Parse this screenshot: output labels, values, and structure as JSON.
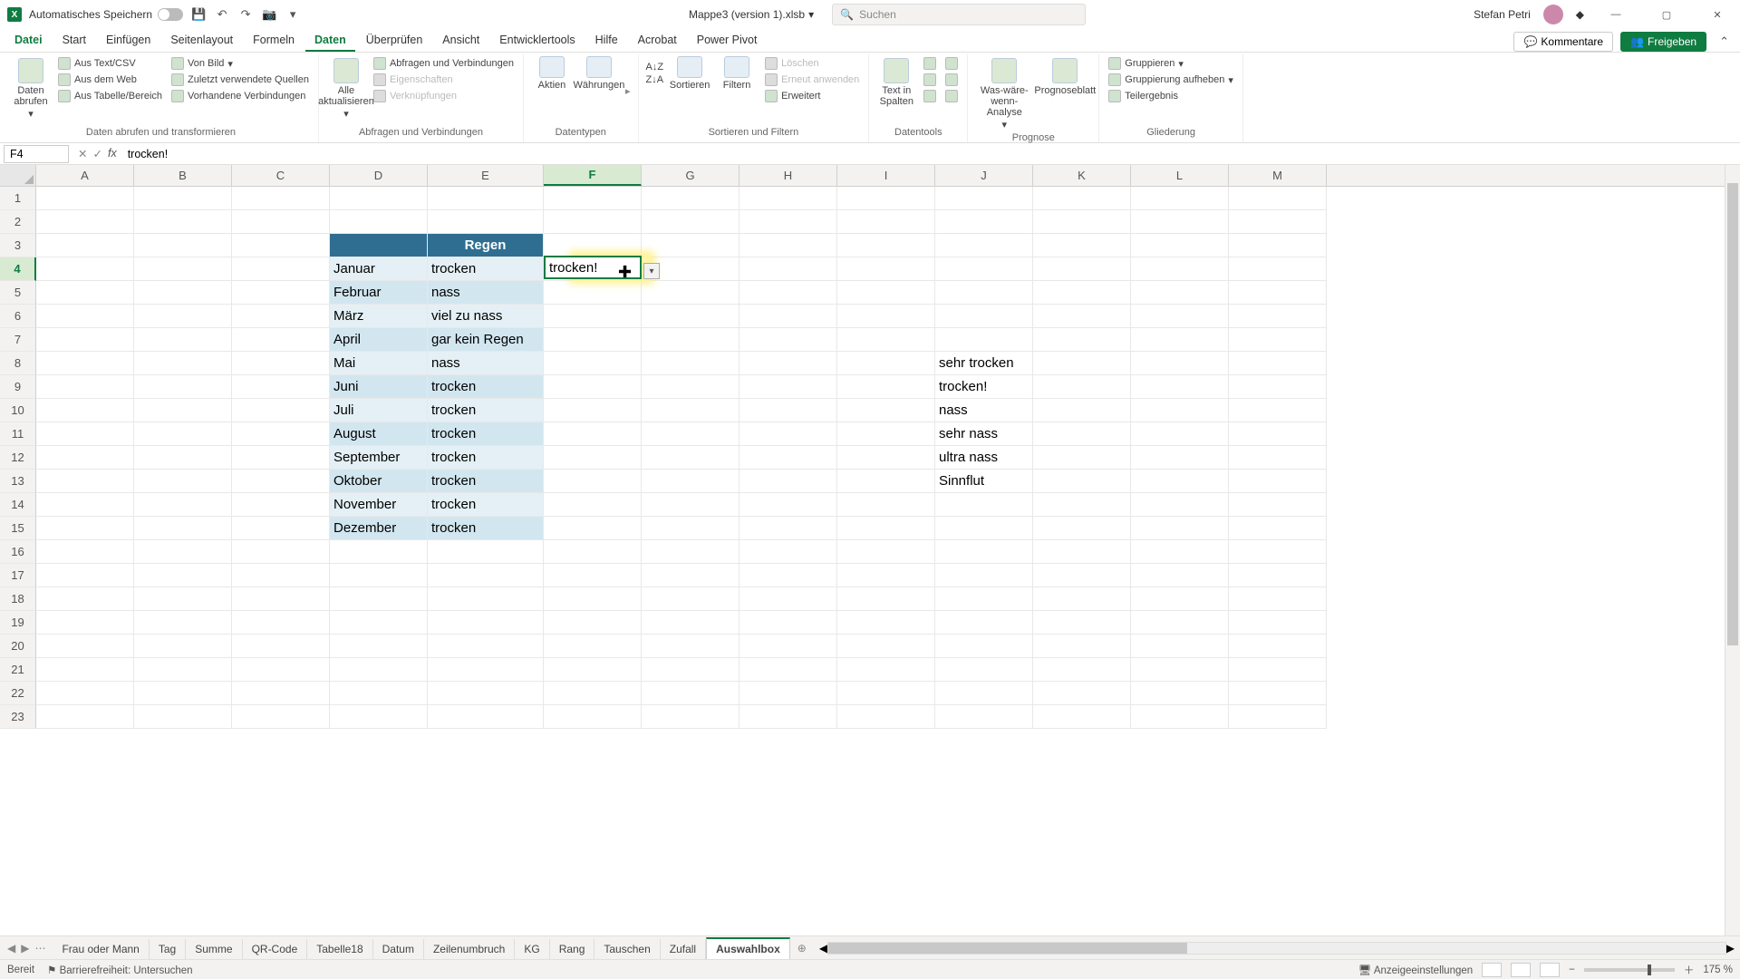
{
  "titlebar": {
    "auto_save": "Automatisches Speichern",
    "filename": "Mappe3 (version 1).xlsb",
    "search_placeholder": "Suchen",
    "username": "Stefan Petri"
  },
  "tabs": {
    "file": "Datei",
    "items": [
      "Start",
      "Einfügen",
      "Seitenlayout",
      "Formeln",
      "Daten",
      "Überprüfen",
      "Ansicht",
      "Entwicklertools",
      "Hilfe",
      "Acrobat",
      "Power Pivot"
    ],
    "active": "Daten",
    "comments": "Kommentare",
    "share": "Freigeben"
  },
  "ribbon": {
    "g1": {
      "btn": "Daten abrufen",
      "i1": "Aus Text/CSV",
      "i2": "Aus dem Web",
      "i3": "Aus Tabelle/Bereich",
      "i4": "Von Bild",
      "i5": "Zuletzt verwendete Quellen",
      "i6": "Vorhandene Verbindungen",
      "title": "Daten abrufen und transformieren"
    },
    "g2": {
      "btn": "Alle aktualisieren",
      "i1": "Abfragen und Verbindungen",
      "i2": "Eigenschaften",
      "i3": "Verknüpfungen",
      "title": "Abfragen und Verbindungen"
    },
    "g3": {
      "b1": "Aktien",
      "b2": "Währungen",
      "title": "Datentypen"
    },
    "g4": {
      "b1": "Sortieren",
      "b2": "Filtern",
      "i1": "Löschen",
      "i2": "Erneut anwenden",
      "i3": "Erweitert",
      "title": "Sortieren und Filtern"
    },
    "g5": {
      "btn": "Text in Spalten",
      "title": "Datentools"
    },
    "g6": {
      "b1": "Was-wäre-wenn-Analyse",
      "b2": "Prognoseblatt",
      "title": "Prognose"
    },
    "g7": {
      "i1": "Gruppieren",
      "i2": "Gruppierung aufheben",
      "i3": "Teilergebnis",
      "title": "Gliederung"
    }
  },
  "formula_bar": {
    "name": "F4",
    "value": "trocken!"
  },
  "columns": [
    "A",
    "B",
    "C",
    "D",
    "E",
    "F",
    "G",
    "H",
    "I",
    "J",
    "K",
    "L",
    "M"
  ],
  "active_col": "F",
  "active_row": 4,
  "table": {
    "h1": "",
    "h2": "Regen",
    "rows": [
      {
        "m": "Januar",
        "v": "trocken"
      },
      {
        "m": "Februar",
        "v": "nass"
      },
      {
        "m": "März",
        "v": "viel zu nass"
      },
      {
        "m": "April",
        "v": "gar kein Regen"
      },
      {
        "m": "Mai",
        "v": "nass"
      },
      {
        "m": "Juni",
        "v": "trocken"
      },
      {
        "m": "Juli",
        "v": "trocken"
      },
      {
        "m": "August",
        "v": "trocken"
      },
      {
        "m": "September",
        "v": "trocken"
      },
      {
        "m": "Oktober",
        "v": "trocken"
      },
      {
        "m": "November",
        "v": "trocken"
      },
      {
        "m": "Dezember",
        "v": "trocken"
      }
    ]
  },
  "active_cell_value": "trocken!",
  "list_J": [
    "sehr trocken",
    "trocken!",
    "nass",
    "sehr nass",
    "ultra nass",
    "Sinnflut"
  ],
  "sheets": {
    "items": [
      "Frau oder Mann",
      "Tag",
      "Summe",
      "QR-Code",
      "Tabelle18",
      "Datum",
      "Zeilenumbruch",
      "KG",
      "Rang",
      "Tauschen",
      "Zufall",
      "Auswahlbox"
    ],
    "active": "Auswahlbox"
  },
  "statusbar": {
    "ready": "Bereit",
    "accessibility": "Barrierefreiheit: Untersuchen",
    "display": "Anzeigeeinstellungen",
    "zoom": "175 %"
  }
}
